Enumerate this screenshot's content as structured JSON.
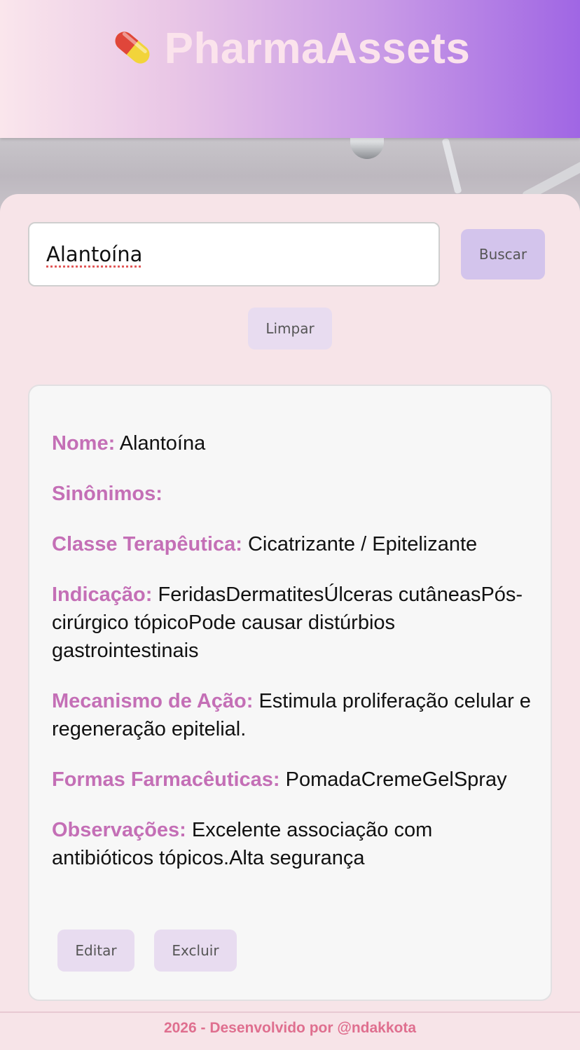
{
  "header": {
    "title": "PharmaAssets",
    "icon": "pill-icon"
  },
  "search": {
    "value": "Alantoína",
    "buscar_label": "Buscar",
    "limpar_label": "Limpar"
  },
  "result": {
    "fields": [
      {
        "label": "Nome:",
        "value": "Alantoína"
      },
      {
        "label": "Sinônimos:",
        "value": ""
      },
      {
        "label": "Classe Terapêutica:",
        "value": "Cicatrizante / Epitelizante"
      },
      {
        "label": "Indicação:",
        "value": "FeridasDermatitesÚlceras cutâneasPós-cirúrgico tópicoPode causar distúrbios gastrointestinais"
      },
      {
        "label": "Mecanismo de Ação:",
        "value": "Estimula proliferação celular e regeneração epitelial."
      },
      {
        "label": "Formas Farmacêuticas:",
        "value": "PomadaCremeGelSpray"
      },
      {
        "label": "Observações:",
        "value": "Excelente associação com antibióticos tópicos.Alta segurança"
      }
    ],
    "editar_label": "Editar",
    "excluir_label": "Excluir"
  },
  "footer": {
    "text": "2026 - Desenvolvido por @ndakkota"
  },
  "colors": {
    "label_color": "#c46fb6",
    "footer_color": "#df6f8f",
    "button_primary": "#d3c4ec",
    "button_secondary": "#e8dcf0",
    "background": "#f7e4e8"
  }
}
